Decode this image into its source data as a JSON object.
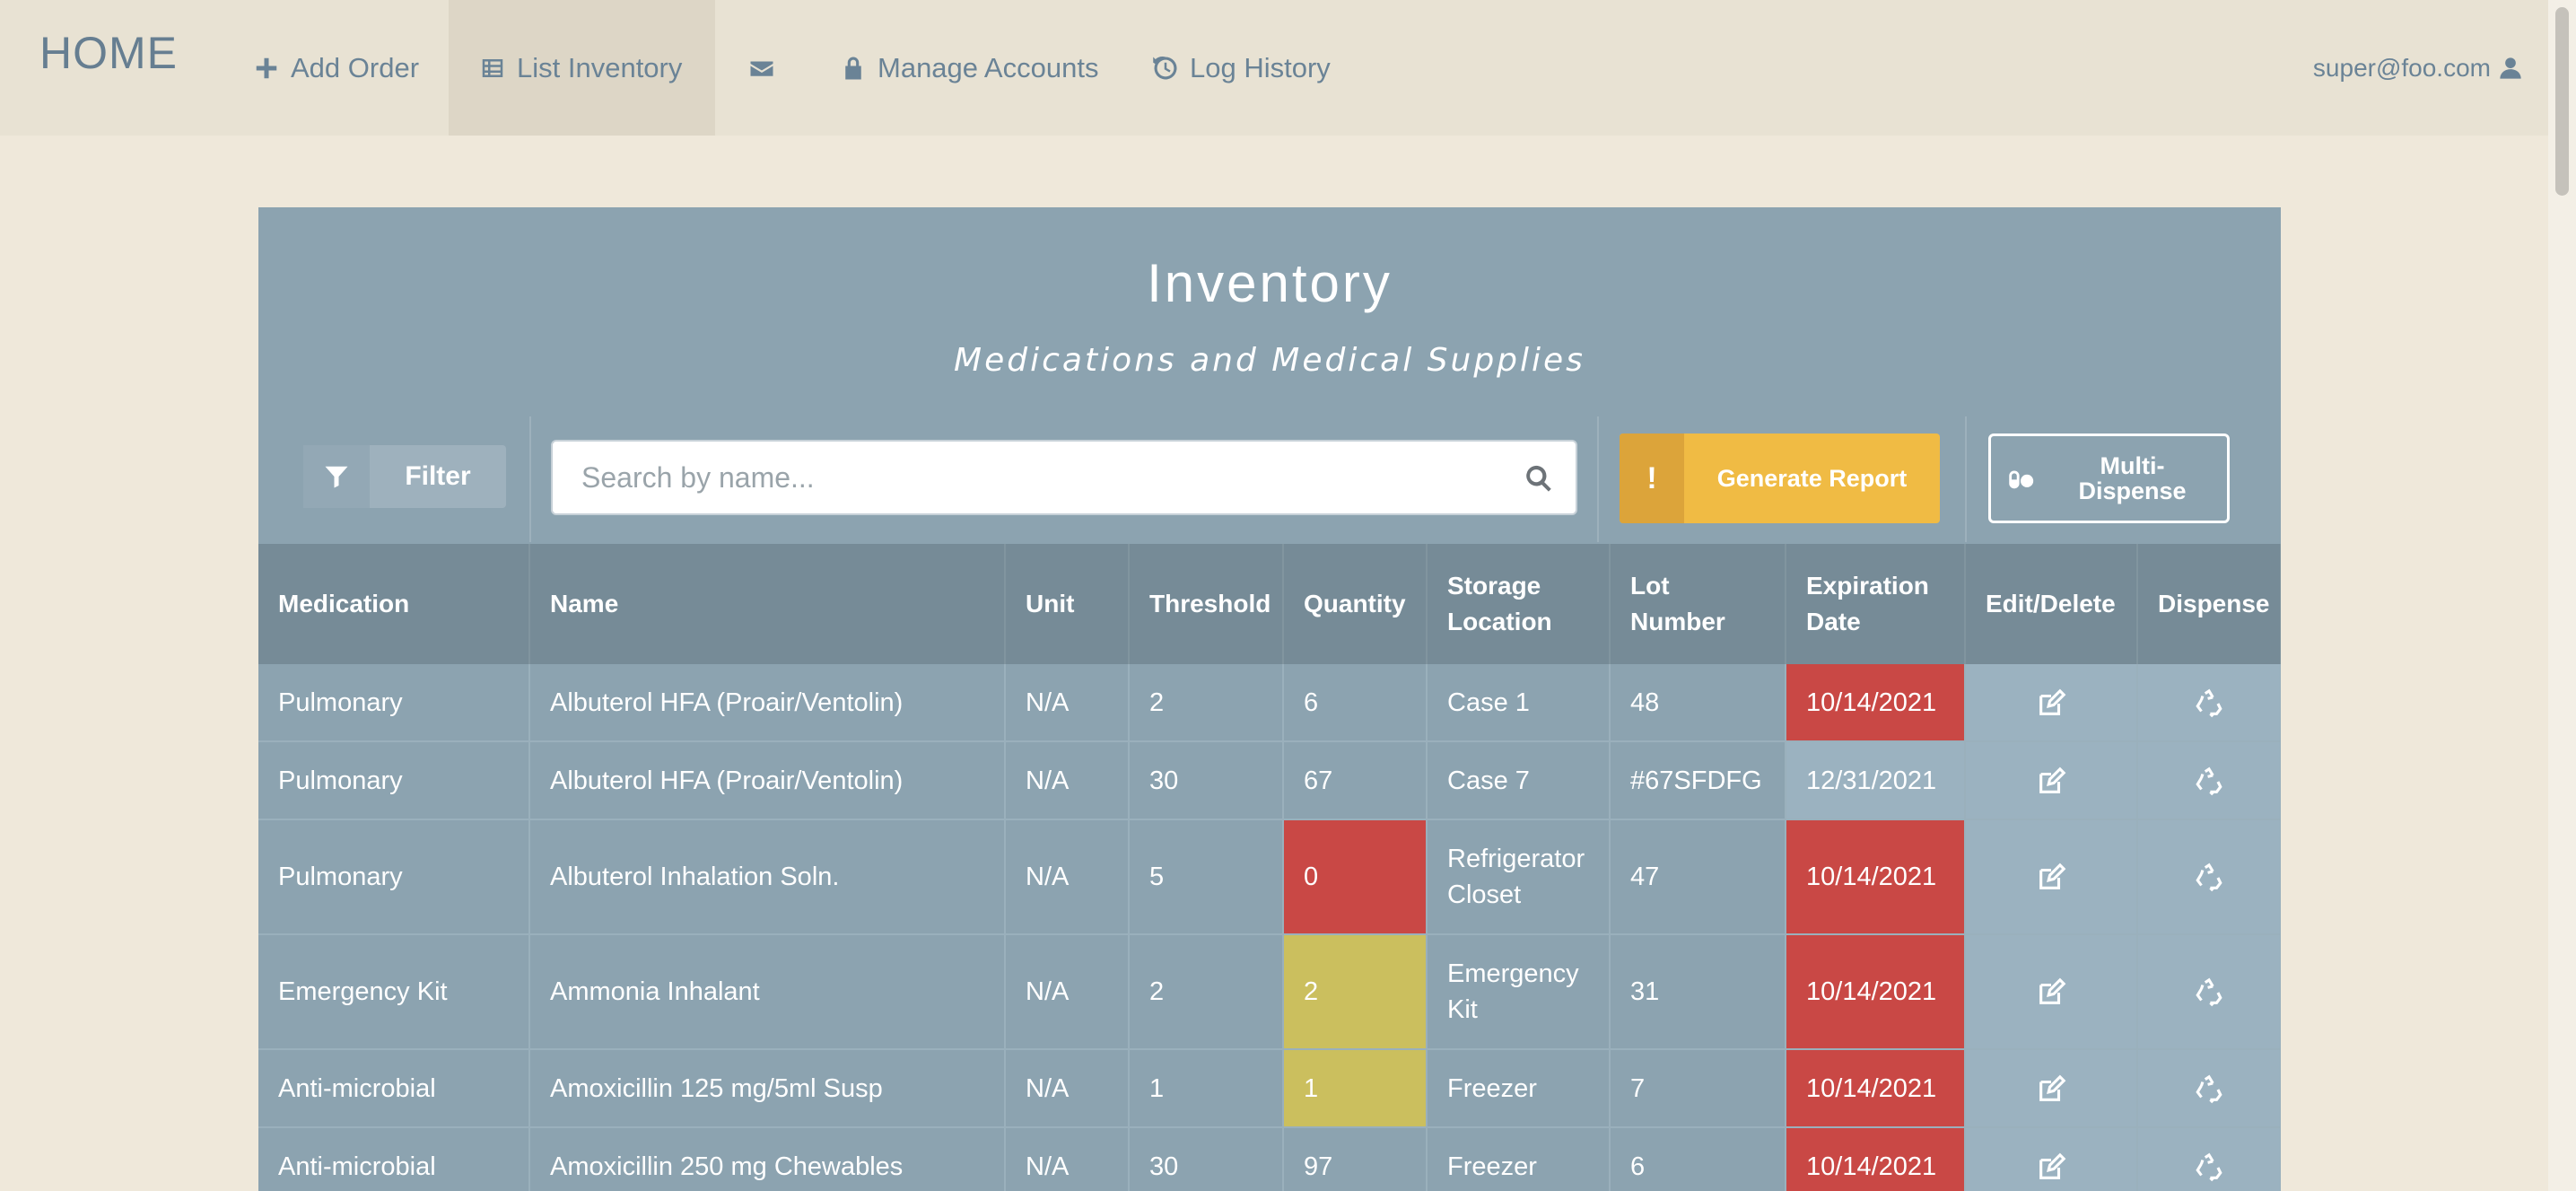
{
  "nav": {
    "brand": "HOME",
    "items": [
      {
        "label": "Add Order",
        "icon": "plus-icon"
      },
      {
        "label": "List Inventory",
        "icon": "list-icon",
        "active": true
      },
      {
        "label": "",
        "icon": "envelope-icon"
      },
      {
        "label": "Manage Accounts",
        "icon": "lock-icon"
      },
      {
        "label": "Log History",
        "icon": "history-icon"
      }
    ],
    "user": "super@foo.com"
  },
  "header": {
    "title": "Inventory",
    "subtitle": "Medications and Medical Supplies"
  },
  "toolbar": {
    "filter_label": "Filter",
    "search_placeholder": "Search by name...",
    "generate_icon_text": "!",
    "generate_label": "Generate Report",
    "multi_dispense_label": "Multi-Dispense"
  },
  "colors": {
    "alert_red": "#c94845",
    "warning_yellow": "#cbbf5e",
    "report_button": "#f0bb44",
    "panel": "#8ca3b0"
  },
  "table": {
    "columns": [
      "Medication",
      "Name",
      "Unit",
      "Threshold",
      "Quantity",
      "Storage Location",
      "Lot Number",
      "Expiration Date",
      "Edit/Delete",
      "Dispense"
    ],
    "rows": [
      {
        "medication": "Pulmonary",
        "name": "Albuterol HFA (Proair/Ventolin)",
        "unit": "N/A",
        "threshold": "2",
        "quantity": "6",
        "quantity_status": "normal",
        "location": "Case 1",
        "lot": "48",
        "expiration": "10/14/2021",
        "expired": true
      },
      {
        "medication": "Pulmonary",
        "name": "Albuterol HFA (Proair/Ventolin)",
        "unit": "N/A",
        "threshold": "30",
        "quantity": "67",
        "quantity_status": "normal",
        "location": "Case 7",
        "lot": "#67SFDFG",
        "expiration": "12/31/2021",
        "expired": false
      },
      {
        "medication": "Pulmonary",
        "name": "Albuterol Inhalation Soln.",
        "unit": "N/A",
        "threshold": "5",
        "quantity": "0",
        "quantity_status": "empty",
        "location": "Refrigerator Closet",
        "lot": "47",
        "expiration": "10/14/2021",
        "expired": true
      },
      {
        "medication": "Emergency Kit",
        "name": "Ammonia Inhalant",
        "unit": "N/A",
        "threshold": "2",
        "quantity": "2",
        "quantity_status": "low",
        "location": "Emergency Kit",
        "lot": "31",
        "expiration": "10/14/2021",
        "expired": true
      },
      {
        "medication": "Anti-microbial",
        "name": "Amoxicillin 125 mg/5ml Susp",
        "unit": "N/A",
        "threshold": "1",
        "quantity": "1",
        "quantity_status": "low",
        "location": "Freezer",
        "lot": "7",
        "expiration": "10/14/2021",
        "expired": true
      },
      {
        "medication": "Anti-microbial",
        "name": "Amoxicillin 250 mg Chewables",
        "unit": "N/A",
        "threshold": "30",
        "quantity": "97",
        "quantity_status": "normal",
        "location": "Freezer",
        "lot": "6",
        "expiration": "10/14/2021",
        "expired": true
      }
    ]
  }
}
